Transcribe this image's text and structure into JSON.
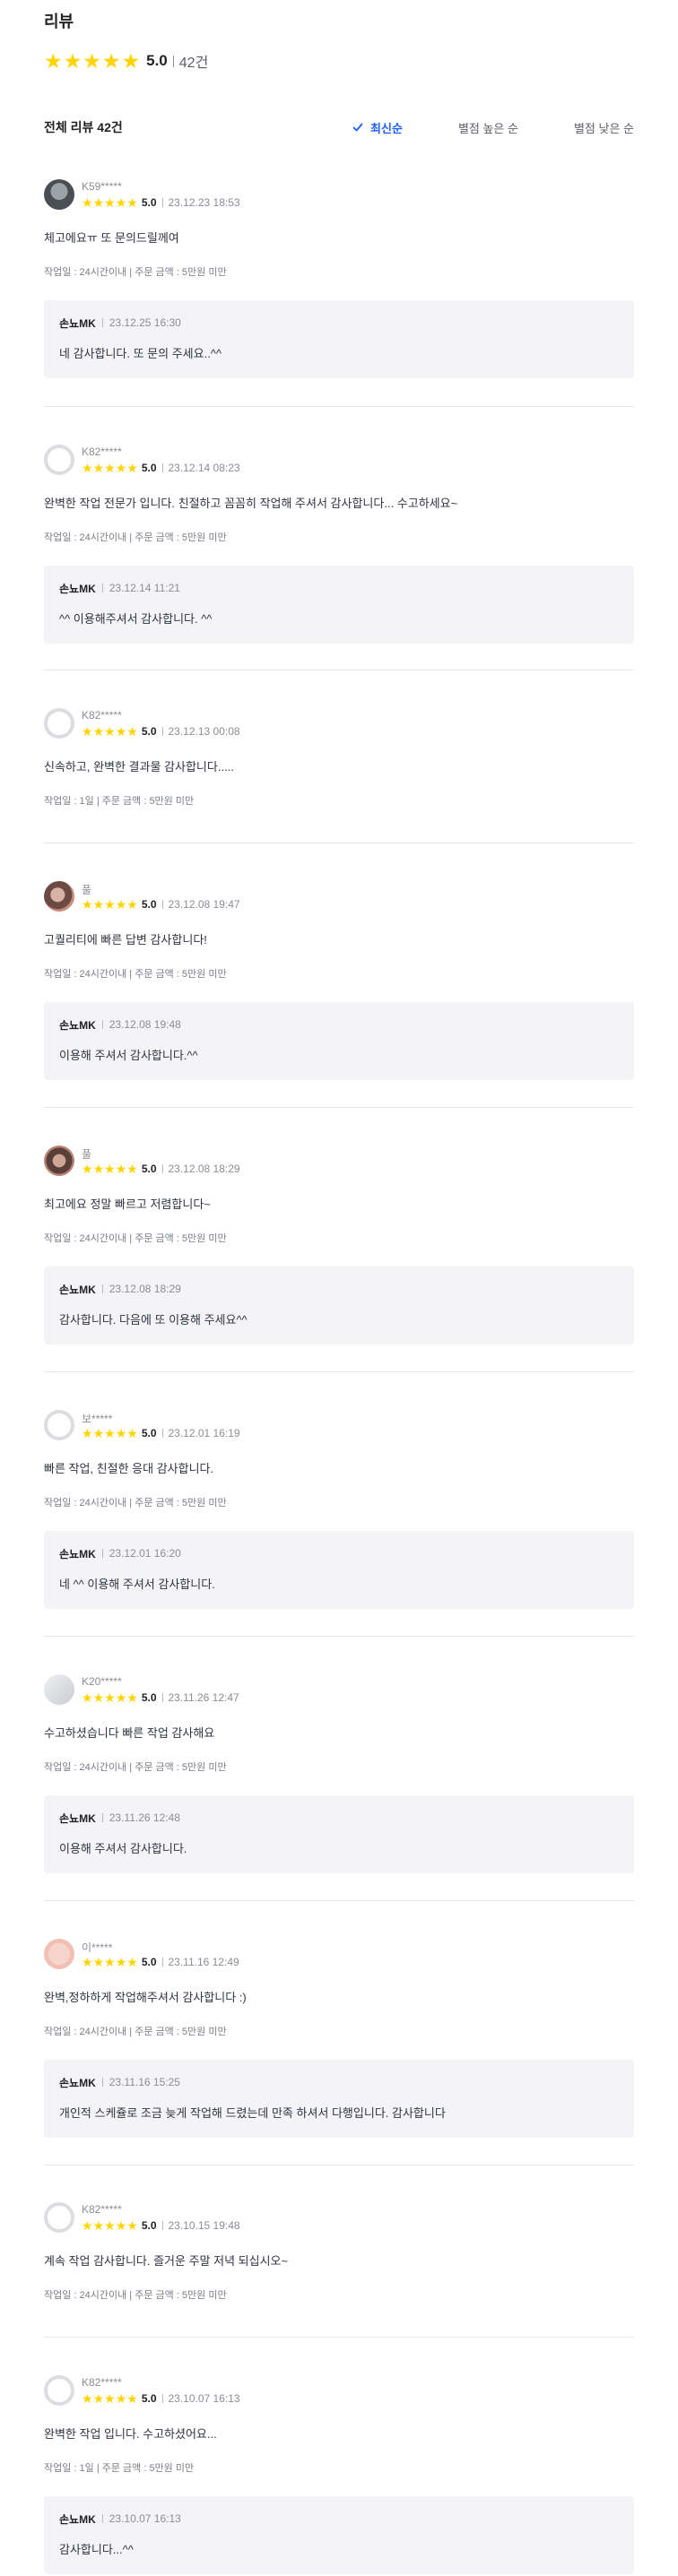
{
  "page": {
    "title": "리뷰",
    "rating": "5.0",
    "count": "42건"
  },
  "toolbar": {
    "total": "전체 리뷰 42건",
    "sort": [
      "최신순",
      "별점 높은 순",
      "별점 낮은 순"
    ],
    "active_sort": "최신순"
  },
  "colors": {
    "star": "#ffd400",
    "accent": "#1e5eff"
  },
  "reviews": [
    {
      "nick": "K59*****",
      "rating": "5.0",
      "date": "23.12.23 18:53",
      "content": "체고에요ㅠ 또 문의드릴께여",
      "meta": "작업일 : 24시간이내 | 주문 금액 : 5만원 미만",
      "reply": {
        "author": "손뇨MK",
        "date": "23.12.25 16:30",
        "text": "네 감사합니다. 또 문의 주세요..^^"
      }
    },
    {
      "nick": "K82*****",
      "rating": "5.0",
      "date": "23.12.14 08:23",
      "content": "완벽한 작업 전문가 입니다. 친절하고 꼼꼼히 작업해 주셔서 감사합니다... 수고하세요~",
      "meta": "작업일 : 24시간이내 | 주문 금액 : 5만원 미만",
      "reply": {
        "author": "손뇨MK",
        "date": "23.12.14 11:21",
        "text": "^^ 이용해주셔서 감사합니다.   ^^"
      }
    },
    {
      "nick": "K82*****",
      "rating": "5.0",
      "date": "23.12.13 00:08",
      "content": "신속하고, 완벽한 결과물 감사합니다.....",
      "meta": "작업일 : 1일 | 주문 금액 : 5만원 미만",
      "reply": null
    },
    {
      "nick": "풀",
      "rating": "5.0",
      "date": "23.12.08 19:47",
      "content": "고퀄리티에 빠른 답변 감사합니다!",
      "meta": "작업일 : 24시간이내 | 주문 금액 : 5만원 미만",
      "reply": {
        "author": "손뇨MK",
        "date": "23.12.08 19:48",
        "text": "이용해 주셔서 감사합니다.^^"
      }
    },
    {
      "nick": "풀",
      "rating": "5.0",
      "date": "23.12.08 18:29",
      "content": "최고에요 정말 빠르고 저렴합니다~",
      "meta": "작업일 : 24시간이내 | 주문 금액 : 5만원 미만",
      "reply": {
        "author": "손뇨MK",
        "date": "23.12.08 18:29",
        "text": "감사합니다. 다음에 또 이용해 주세요^^"
      }
    },
    {
      "nick": "보*****",
      "rating": "5.0",
      "date": "23.12.01 16:19",
      "content": "빠른 작업, 친절한 응대 감사합니다.",
      "meta": "작업일 : 24시간이내 | 주문 금액 : 5만원 미만",
      "reply": {
        "author": "손뇨MK",
        "date": "23.12.01 16:20",
        "text": "네 ^^ 이용해 주셔서 감사합니다."
      }
    },
    {
      "nick": "K20*****",
      "rating": "5.0",
      "date": "23.11.26 12:47",
      "content": "수고하셨습니다 빠른 작업 감사해요",
      "meta": "작업일 : 24시간이내 | 주문 금액 : 5만원 미만",
      "reply": {
        "author": "손뇨MK",
        "date": "23.11.26 12:48",
        "text": "이용해 주셔서 감사합니다."
      }
    },
    {
      "nick": "이*****",
      "rating": "5.0",
      "date": "23.11.16 12:49",
      "content": "완벽,정하하게 작업해주셔서 감사합니다 :)",
      "meta": "작업일 : 24시간이내 | 주문 금액 : 5만원 미만",
      "reply": {
        "author": "손뇨MK",
        "date": "23.11.16 15:25",
        "text": "개인적 스케쥴로 조금 늦게 작업해 드렸는데 만족 하셔서 다행입니다.   감사합니다"
      }
    },
    {
      "nick": "K82*****",
      "rating": "5.0",
      "date": "23.10.15 19:48",
      "content": "계속 작업 감사합니다. 즐거운 주말 저녁 되십시오~",
      "meta": "작업일 : 24시간이내 | 주문 금액 : 5만원 미만",
      "reply": null
    },
    {
      "nick": "K82*****",
      "rating": "5.0",
      "date": "23.10.07 16:13",
      "content": "완벽한 작업 입니다. 수고하셨어요...",
      "meta": "작업일 : 1일 | 주문 금액 : 5만원 미만",
      "reply": {
        "author": "손뇨MK",
        "date": "23.10.07 16:13",
        "text": "감사합니다...^^"
      }
    }
  ]
}
